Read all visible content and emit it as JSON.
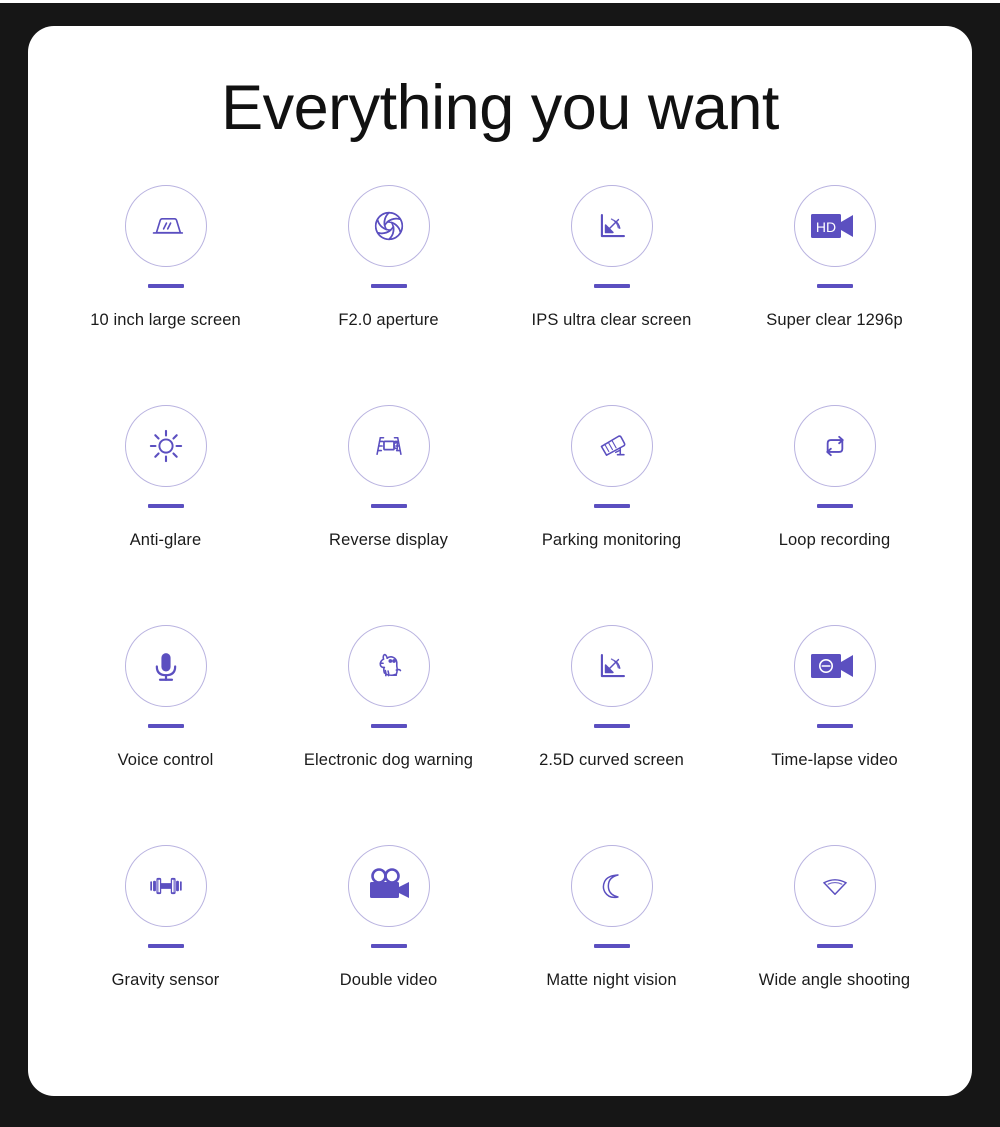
{
  "page": {
    "background_color": "#161616",
    "card_color": "#ffffff",
    "accent_color": "#5b4fc0",
    "circle_border_color": "#b9b3e0",
    "title": "Everything you want"
  },
  "features": [
    {
      "label": "10 inch large screen",
      "icon": "large-screen-icon",
      "style": "outline"
    },
    {
      "label": "F2.0 aperture",
      "icon": "aperture-icon",
      "style": "outline"
    },
    {
      "label": "IPS ultra clear screen",
      "icon": "viewing-angle-icon",
      "style": "outline"
    },
    {
      "label": "Super clear 1296p",
      "icon": "hd-camera-icon",
      "style": "filled",
      "badge_text": "HD"
    },
    {
      "label": "Anti-glare",
      "icon": "sun-brightness-icon",
      "style": "outline"
    },
    {
      "label": "Reverse display",
      "icon": "reverse-camera-icon",
      "style": "outline"
    },
    {
      "label": "Parking monitoring",
      "icon": "cctv-camera-icon",
      "style": "outline"
    },
    {
      "label": "Loop recording",
      "icon": "loop-arrows-icon",
      "style": "outline"
    },
    {
      "label": "Voice control",
      "icon": "microphone-icon",
      "style": "filled"
    },
    {
      "label": "Electronic dog warning",
      "icon": "dog-icon",
      "style": "outline"
    },
    {
      "label": "2.5D curved screen",
      "icon": "viewing-angle-icon",
      "style": "outline"
    },
    {
      "label": "Time-lapse video",
      "icon": "timelapse-camera-icon",
      "style": "filled"
    },
    {
      "label": "Gravity sensor",
      "icon": "dumbbell-icon",
      "style": "filled"
    },
    {
      "label": "Double video",
      "icon": "movie-camera-icon",
      "style": "filled"
    },
    {
      "label": "Matte night vision",
      "icon": "crescent-moon-icon",
      "style": "outline"
    },
    {
      "label": "Wide angle shooting",
      "icon": "wide-angle-icon",
      "style": "outline"
    }
  ]
}
